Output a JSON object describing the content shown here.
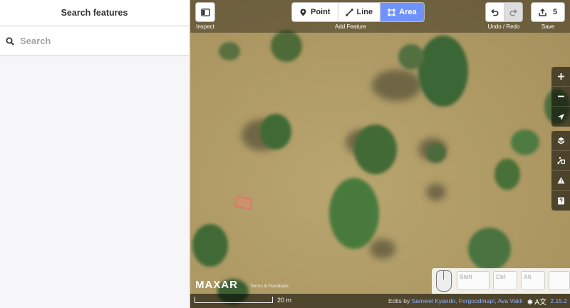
{
  "sidebar": {
    "title": "Search features",
    "search_placeholder": "Search"
  },
  "toolbar": {
    "inspect_label": "Inspect",
    "point_label": "Point",
    "line_label": "Line",
    "area_label": "Area",
    "add_feature_label": "Add Feature",
    "undo_redo_label": "Undo / Redo",
    "save_count": "5",
    "save_label": "Save"
  },
  "map": {
    "imagery_brand": "MAXAR",
    "terms_link": "Terms & Feedback",
    "scale_text": "20 m",
    "edits_prefix": "Edits by",
    "edits_names": "Samwel Kyando, Forgoodmap!, Ava Vakil",
    "version": "2.15.2"
  },
  "keyboard": {
    "keys": [
      "Shift",
      "Ctrl",
      "Alt"
    ]
  },
  "colors": {
    "accent": "#7092ff",
    "link": "#8fb2ff"
  }
}
